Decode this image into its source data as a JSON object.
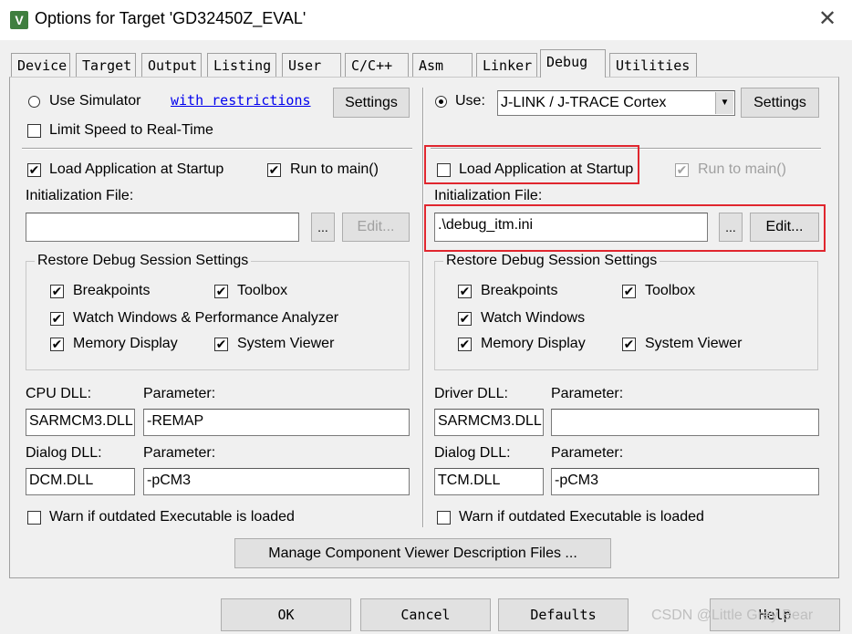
{
  "window": {
    "title": "Options for Target 'GD32450Z_EVAL'",
    "icon": "keil-uvision-icon",
    "close_glyph": "✕"
  },
  "tabs": [
    {
      "label": "Device"
    },
    {
      "label": "Target"
    },
    {
      "label": "Output"
    },
    {
      "label": "Listing"
    },
    {
      "label": "User"
    },
    {
      "label": "C/C++"
    },
    {
      "label": "Asm"
    },
    {
      "label": "Linker"
    },
    {
      "label": "Debug",
      "active": true
    },
    {
      "label": "Utilities"
    }
  ],
  "left": {
    "use_simulator": {
      "label": "Use Simulator",
      "selected": false
    },
    "restrictions_link": "with restrictions",
    "settings_button": "Settings",
    "limit_speed": {
      "label": "Limit Speed to Real-Time",
      "checked": false
    },
    "load_app": {
      "label": "Load Application at Startup",
      "checked": true
    },
    "run_to_main": {
      "label": "Run to main()",
      "checked": true
    },
    "init_file_label": "Initialization File:",
    "init_file_value": "",
    "browse_button": "...",
    "edit_button": "Edit...",
    "restore_group": "Restore Debug Session Settings",
    "breakpoints": {
      "label": "Breakpoints",
      "checked": true
    },
    "toolbox": {
      "label": "Toolbox",
      "checked": true
    },
    "watch": {
      "label": "Watch Windows & Performance Analyzer",
      "checked": true
    },
    "memory": {
      "label": "Memory Display",
      "checked": true
    },
    "sysviewer": {
      "label": "System Viewer",
      "checked": true
    },
    "cpu_dll_label": "CPU DLL:",
    "cpu_param_label": "Parameter:",
    "cpu_dll_value": "SARMCM3.DLL",
    "cpu_param_value": "-REMAP",
    "dialog_dll_label": "Dialog DLL:",
    "dialog_param_label": "Parameter:",
    "dialog_dll_value": "DCM.DLL",
    "dialog_param_value": "-pCM3",
    "warn": {
      "label": "Warn if outdated Executable is loaded",
      "checked": false
    }
  },
  "right": {
    "use_label": "Use:",
    "use_selected": true,
    "driver_select": "J-LINK / J-TRACE Cortex",
    "settings_button": "Settings",
    "load_app": {
      "label": "Load Application at Startup",
      "checked": false
    },
    "run_to_main": {
      "label": "Run to main()",
      "checked": true,
      "disabled": true
    },
    "init_file_label": "Initialization File:",
    "init_file_value": ".\\debug_itm.ini",
    "browse_button": "...",
    "edit_button": "Edit...",
    "restore_group": "Restore Debug Session Settings",
    "breakpoints": {
      "label": "Breakpoints",
      "checked": true
    },
    "toolbox": {
      "label": "Toolbox",
      "checked": true
    },
    "watch": {
      "label": "Watch Windows",
      "checked": true
    },
    "memory": {
      "label": "Memory Display",
      "checked": true
    },
    "sysviewer": {
      "label": "System Viewer",
      "checked": true
    },
    "driver_dll_label": "Driver DLL:",
    "driver_param_label": "Parameter:",
    "driver_dll_value": "SARMCM3.DLL",
    "driver_param_value": "",
    "dialog_dll_label": "Dialog DLL:",
    "dialog_param_label": "Parameter:",
    "dialog_dll_value": "TCM.DLL",
    "dialog_param_value": "-pCM3",
    "warn": {
      "label": "Warn if outdated Executable is loaded",
      "checked": false
    }
  },
  "manage_button": "Manage Component Viewer Description Files ...",
  "footer": {
    "ok": "OK",
    "cancel": "Cancel",
    "defaults": "Defaults",
    "help": "Help"
  },
  "watermark": "CSDN @Little Grey Bear",
  "colors": {
    "highlight": "#e0262e",
    "link": "#0000ee",
    "dialog_bg": "#f0f0f0"
  },
  "check_glyph": "✔"
}
